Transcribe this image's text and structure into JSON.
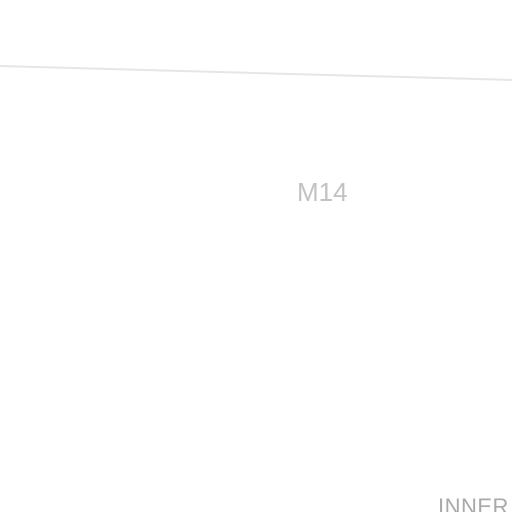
{
  "map": {
    "road_label": "M14",
    "area_label": "INNER"
  },
  "colors": {
    "background": "#ffffff",
    "road_line": "#e6e6e6",
    "road_label": "#c2c2c2",
    "area_label": "#a9a9a9"
  }
}
